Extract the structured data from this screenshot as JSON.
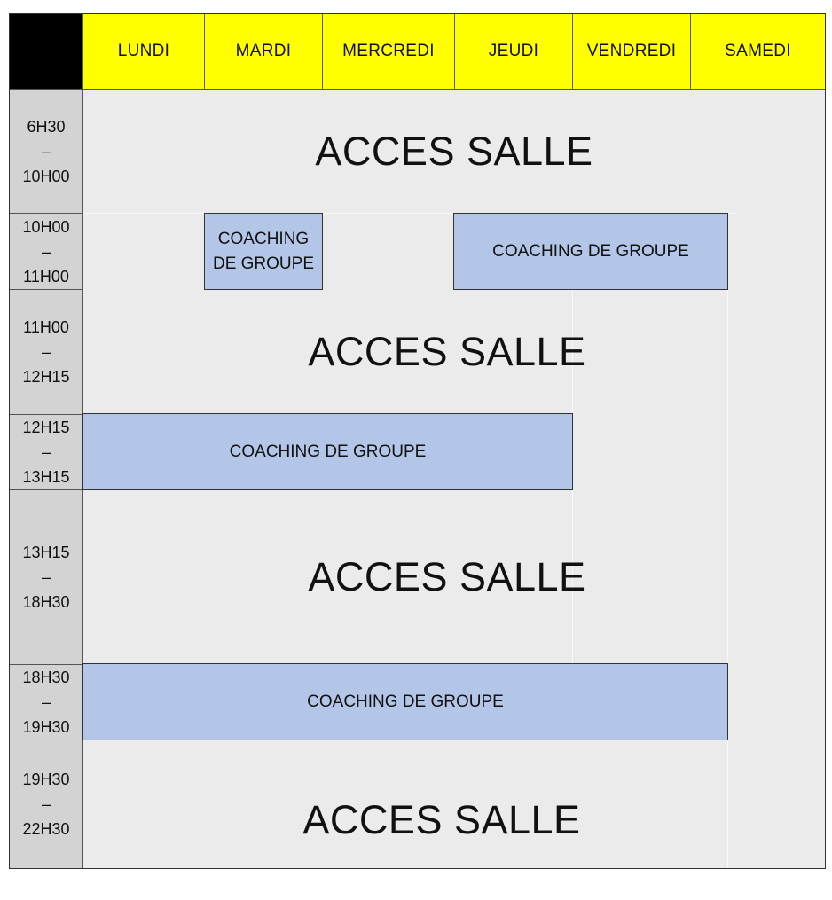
{
  "header": {
    "days": [
      "LUNDI",
      "MARDI",
      "MERCREDI",
      "JEUDI",
      "VENDREDI",
      "SAMEDI"
    ]
  },
  "times": [
    [
      "6H30",
      "–",
      "10H00"
    ],
    [
      "10H00",
      "–",
      "11H00"
    ],
    [
      "11H00",
      "–",
      "12H15"
    ],
    [
      "12H15",
      "–",
      "13H15"
    ],
    [
      "13H15",
      "–",
      "18H30"
    ],
    [
      "18H30",
      "–",
      "19H30"
    ],
    [
      "19H30",
      "–",
      "22H30"
    ]
  ],
  "activities": {
    "acces_salle": "ACCES SALLE",
    "coaching": "COACHING DE GROUPE",
    "coaching_line1": "COACHING",
    "coaching_line2": "DE GROUPE"
  },
  "colors": {
    "header_bg": "#ffff00",
    "time_bg": "#d3d3d3",
    "acces_bg": "#ebebeb",
    "coaching_bg": "#b4c6e7"
  }
}
